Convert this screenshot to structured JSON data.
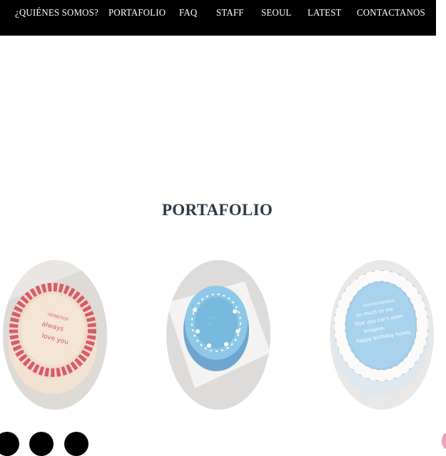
{
  "nav": {
    "items": [
      {
        "label": "¿QUIÉNES SOMOS?"
      },
      {
        "label": "PORTAFOLIO"
      },
      {
        "label": "FAQ"
      },
      {
        "label": "STAFF"
      },
      {
        "label": "SEOUL"
      },
      {
        "label": "LATEST"
      },
      {
        "label": "CONTACTANOS"
      }
    ]
  },
  "portfolio": {
    "title": "PORTAFOLIO",
    "items": [
      {
        "cake_text": "I wish always love you",
        "frosting_color": "#d95a6c",
        "base_color": "#efd9c4"
      },
      {
        "cake_text": "",
        "frosting_color": "#8ec8e6",
        "base_color": "#7db4d9"
      },
      {
        "cake_text": "you mean so much to me that you can't even imagine. happy birthday honey",
        "frosting_color": "#9fcbe7",
        "base_color": "#f6f6f6"
      }
    ]
  },
  "colors": {
    "nav_background": "#000000",
    "nav_text": "#ffffff",
    "title_text": "#2d3942"
  }
}
